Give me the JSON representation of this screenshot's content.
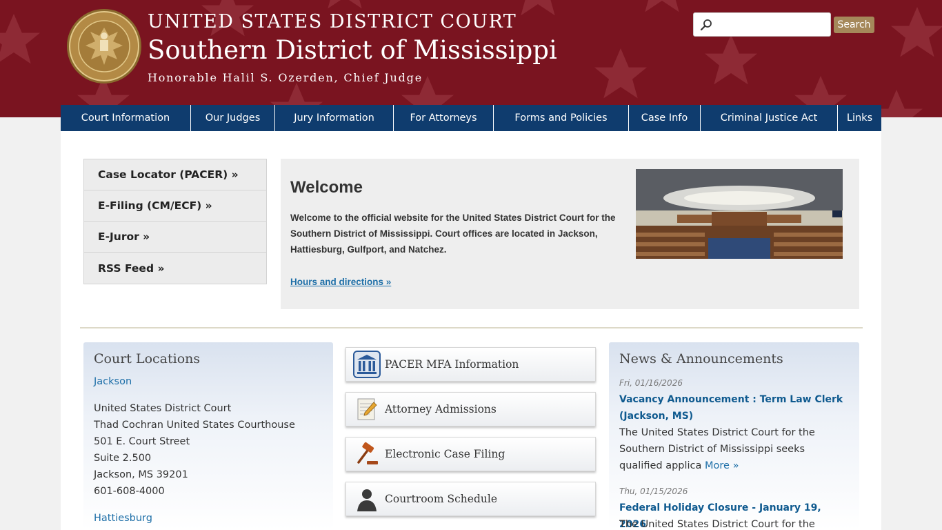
{
  "header": {
    "line1": "UNITED STATES DISTRICT COURT",
    "line2": "Southern District of Mississippi",
    "line3": "Honorable Halil S. Ozerden, Chief Judge"
  },
  "search": {
    "placeholder": "",
    "button_label": "Search"
  },
  "nav": {
    "items": [
      {
        "label": "Court Information"
      },
      {
        "label": "Our Judges"
      },
      {
        "label": "Jury Information"
      },
      {
        "label": "For Attorneys"
      },
      {
        "label": "Forms and Policies"
      },
      {
        "label": "Case Info"
      },
      {
        "label": "Criminal Justice Act"
      },
      {
        "label": "Links"
      }
    ]
  },
  "quick_links": [
    {
      "label": "Case Locator (PACER) »"
    },
    {
      "label": "E-Filing (CM/ECF) »"
    },
    {
      "label": "E-Juror »"
    },
    {
      "label": "RSS Feed »"
    }
  ],
  "welcome": {
    "title": "Welcome",
    "body": "Welcome to the official website for the United States District Court for the Southern District of Mississippi. Court offices are located in Jackson, Hattiesburg, Gulfport, and Natchez.",
    "link": "Hours and directions »"
  },
  "locations": {
    "title": "Court Locations",
    "jackson_link": "Jackson",
    "jackson_lines": [
      "United States District Court",
      "Thad Cochran United States Courthouse",
      "501 E. Court Street",
      "Suite 2.500",
      "Jackson, MS 39201",
      "601-608-4000"
    ],
    "hattiesburg_link": "Hattiesburg"
  },
  "services": [
    {
      "label": "PACER MFA Information",
      "icon": "courthouse-icon"
    },
    {
      "label": "Attorney Admissions",
      "icon": "notepad-pencil-icon"
    },
    {
      "label": "Electronic Case Filing",
      "icon": "gavel-icon"
    },
    {
      "label": "Courtroom Schedule",
      "icon": "person-silhouette-icon"
    }
  ],
  "news": {
    "title": "News & Announcements",
    "items": [
      {
        "date": "Fri, 01/16/2026",
        "title": "Vacancy Announcement : Term Law Clerk (Jackson, MS)",
        "body": "The United States District Court for the Southern District of Mississippi seeks qualified applica",
        "more": "More »"
      },
      {
        "date": "Thu, 01/15/2026",
        "title": "Federal Holiday Closure - January 19, 2026",
        "body": "The United States District Court for the"
      }
    ]
  },
  "colors": {
    "header_red": "#7a1420",
    "nav_blue": "#0f3c6e",
    "search_button": "#a5885a",
    "link_blue": "#1e6fa8"
  }
}
